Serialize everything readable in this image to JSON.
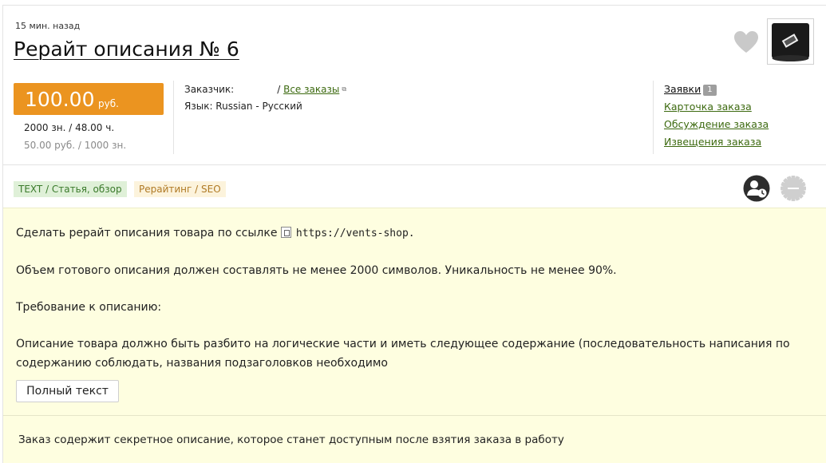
{
  "order": {
    "time_ago": "15 мин. назад",
    "title": "Рерайт описания № 6",
    "price": "100.00",
    "currency": "руб.",
    "volume_line": "2000 зн. / 48.00 ч.",
    "rate_line": "50.00 руб. / 1000 зн.",
    "customer_label": "Заказчик:",
    "all_orders_sep": "/",
    "all_orders_link": "Все заказы",
    "language_line": "Язык: Russian - Русский"
  },
  "side_links": {
    "bids_label": "Заявки",
    "bids_count": "1",
    "card": "Карточка заказа",
    "discussion": "Обсуждение заказа",
    "notices": "Извещения заказа"
  },
  "tags": {
    "category": "TEXT / Статья, обзор",
    "subcategory": "Рерайтинг / SEO"
  },
  "description": {
    "line1_prefix": "Сделать рерайт описания товара по ссылке",
    "line1_url": "https://vents-shop.",
    "line2": "Объем готового описания должен составлять не менее 2000 символов. Уникальность не менее 90%.",
    "line3": "Требование к описанию:",
    "line4": "Описание товара должно быть разбито на логические части и иметь следующее содержание (последовательность написания по",
    "line5": "содержанию соблюдать, названия подзаголовков необходимо",
    "full_text_button": "Полный текст"
  },
  "secret_notice": "Заказ содержит секретное описание, которое станет доступным после взятия заказа в работу",
  "colors": {
    "price_bg": "#eb9420",
    "link": "#3d6a10",
    "desc_bg": "#fefee0",
    "tag1_bg": "#dff0d8",
    "tag2_bg": "#fcf3dc"
  },
  "icons": [
    "heart-icon",
    "product-thumbnail",
    "user-clock-icon",
    "gear-icon",
    "external-link-icon",
    "url-link-icon"
  ]
}
